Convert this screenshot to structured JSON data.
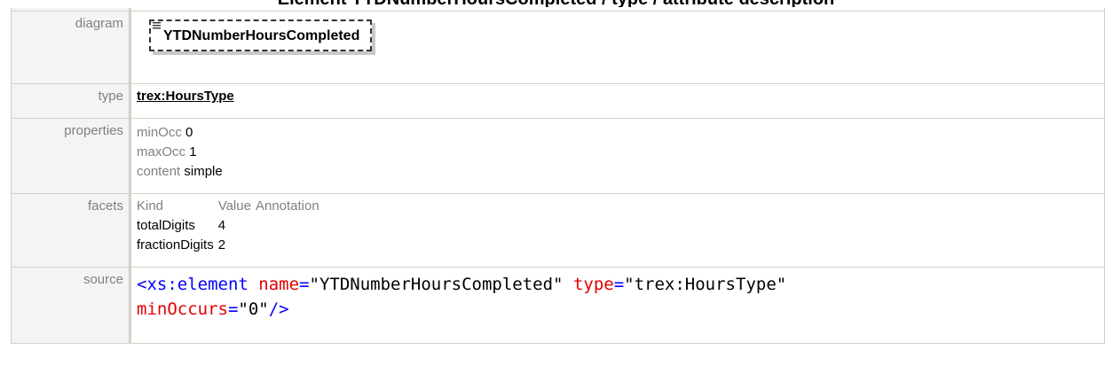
{
  "heading": "Element YTDNumberHoursCompleted / type / attribute description",
  "rows": {
    "diagram": {
      "label": "diagram",
      "element_name": "YTDNumberHoursCompleted",
      "icon": "element-list-icon"
    },
    "type": {
      "label": "type",
      "value": "trex:HoursType"
    },
    "properties": {
      "label": "properties",
      "items": [
        {
          "key": "minOcc",
          "value": "0"
        },
        {
          "key": "maxOcc",
          "value": "1"
        },
        {
          "key": "content",
          "value": "simple"
        }
      ]
    },
    "facets": {
      "label": "facets",
      "headers": [
        "Kind",
        "Value",
        "Annotation"
      ],
      "items": [
        {
          "kind": "totalDigits",
          "value": "4",
          "annotation": ""
        },
        {
          "kind": "fractionDigits",
          "value": "2",
          "annotation": ""
        }
      ]
    },
    "source": {
      "label": "source",
      "tag_open": "<xs:element",
      "attr1_name": "name",
      "attr1_value": "\"YTDNumberHoursCompleted\"",
      "attr2_name": "type",
      "attr2_value": "\"trex:HoursType\"",
      "attr3_name": "minOccurs",
      "attr3_value": "\"0\"",
      "tag_close": "/>"
    }
  },
  "colors": {
    "border": "#d4d0c8",
    "label_bg": "#f4f4f4",
    "label_text": "#808080",
    "tag": "#800000",
    "attr": "#e00000",
    "punct": "#0000ff"
  }
}
